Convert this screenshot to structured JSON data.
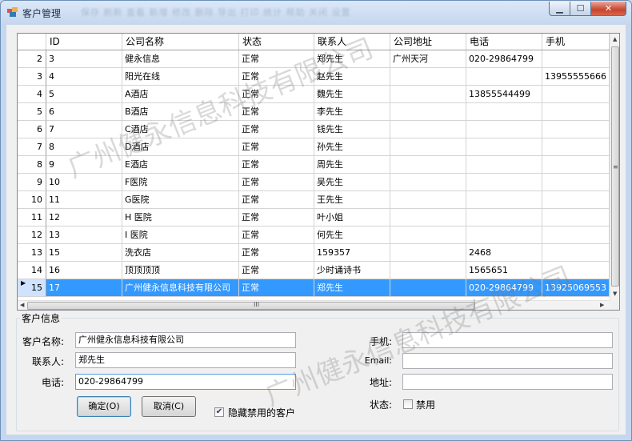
{
  "window": {
    "title": "客户管理",
    "title_blur": "保存 刷新 查看 新增 修改 删除 导出 打印 统计 帮助 关闭 设置"
  },
  "grid": {
    "columns": [
      "ID",
      "公司名称",
      "状态",
      "联系人",
      "公司地址",
      "电话",
      "手机"
    ],
    "rows": [
      {
        "num": "2",
        "cells": [
          "3",
          "健永信息",
          "正常",
          "郑先生",
          "广州天河",
          "020-29864799",
          ""
        ]
      },
      {
        "num": "3",
        "cells": [
          "4",
          "阳光在线",
          "正常",
          "赵先生",
          "",
          "",
          "13955555666"
        ]
      },
      {
        "num": "4",
        "cells": [
          "5",
          "A酒店",
          "正常",
          "魏先生",
          "",
          "13855544499",
          ""
        ]
      },
      {
        "num": "5",
        "cells": [
          "6",
          "B酒店",
          "正常",
          "李先生",
          "",
          "",
          ""
        ]
      },
      {
        "num": "6",
        "cells": [
          "7",
          "C酒店",
          "正常",
          "钱先生",
          "",
          "",
          ""
        ]
      },
      {
        "num": "7",
        "cells": [
          "8",
          "D酒店",
          "正常",
          "孙先生",
          "",
          "",
          ""
        ]
      },
      {
        "num": "8",
        "cells": [
          "9",
          "E酒店",
          "正常",
          "周先生",
          "",
          "",
          ""
        ]
      },
      {
        "num": "9",
        "cells": [
          "10",
          "F医院",
          "正常",
          "吴先生",
          "",
          "",
          ""
        ]
      },
      {
        "num": "10",
        "cells": [
          "11",
          "G医院",
          "正常",
          "王先生",
          "",
          "",
          ""
        ]
      },
      {
        "num": "11",
        "cells": [
          "12",
          "H 医院",
          "正常",
          "叶小姐",
          "",
          "",
          ""
        ]
      },
      {
        "num": "12",
        "cells": [
          "13",
          "I 医院",
          "正常",
          "何先生",
          "",
          "",
          ""
        ]
      },
      {
        "num": "13",
        "cells": [
          "15",
          "洗衣店",
          "正常",
          "159357",
          "",
          "2468",
          ""
        ]
      },
      {
        "num": "14",
        "cells": [
          "16",
          "顶顶顶顶",
          "正常",
          "少时诵诗书",
          "",
          "1565651",
          ""
        ]
      },
      {
        "num": "15",
        "cells": [
          "17",
          "广州健永信息科技有限公司",
          "正常",
          "郑先生",
          "",
          "020-29864799",
          "13925069553"
        ],
        "selected": true
      }
    ],
    "scroll_grip": "≡",
    "hscroll_grip": "III"
  },
  "form": {
    "group_title": "客户信息",
    "company_label": "客户名称:",
    "company_value": "广州健永信息科技有限公司",
    "contact_label": "联系人:",
    "contact_value": "郑先生",
    "phone_label": "电话:",
    "phone_value": "020-29864799",
    "mobile_label": "手机:",
    "mobile_value": "",
    "email_label": "Email:",
    "email_value": "",
    "address_label": "地址:",
    "address_value": "",
    "status_label": "状态:",
    "disabled_label": "禁用",
    "hide_disabled_label": "隐藏禁用的客户",
    "ok_button": "确定(O)",
    "cancel_button": "取消(C)"
  },
  "watermark": "广州健永信息科技有限公司",
  "colors": {
    "selection": "#3399ff",
    "title_bg": "#c5d7ee",
    "close_btn": "#c7442d"
  }
}
